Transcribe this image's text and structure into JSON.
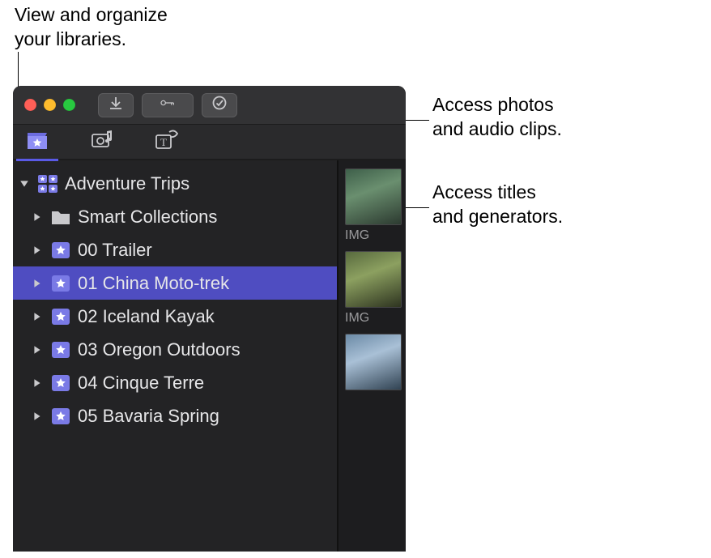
{
  "callouts": {
    "libraries": "View and organize\nyour libraries.",
    "photos_audio": "Access photos\nand audio clips.",
    "titles_gen": "Access titles\nand generators."
  },
  "library": {
    "name": "Adventure Trips",
    "items": [
      {
        "label": "Smart Collections",
        "type": "folder",
        "selected": false
      },
      {
        "label": "00 Trailer",
        "type": "event",
        "selected": false
      },
      {
        "label": "01 China Moto-trek",
        "type": "event",
        "selected": true
      },
      {
        "label": "02 Iceland Kayak",
        "type": "event",
        "selected": false
      },
      {
        "label": "03 Oregon Outdoors",
        "type": "event",
        "selected": false
      },
      {
        "label": "04 Cinque Terre",
        "type": "event",
        "selected": false
      },
      {
        "label": "05 Bavaria Spring",
        "type": "event",
        "selected": false
      }
    ]
  },
  "thumbs": {
    "label1": "IMG",
    "label2": "IMG"
  }
}
